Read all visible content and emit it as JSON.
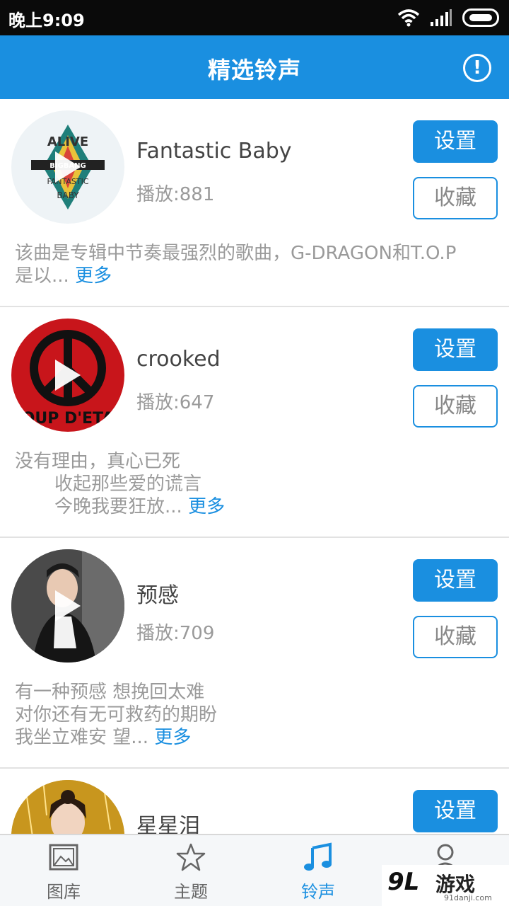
{
  "status_bar": {
    "time": "晚上9:09"
  },
  "header": {
    "title": "精选铃声",
    "info_icon": "!"
  },
  "items": [
    {
      "title": "Fantastic Baby",
      "plays": "播放:881",
      "set_label": "设置",
      "fav_label": "收藏",
      "desc_lines": [
        "该曲是专辑中节奏最强烈的歌曲，G-DRAGON和T.O.P",
        "是以..."
      ],
      "more": "更多",
      "cover_text": [
        "ALIVE",
        "BIGBANG",
        "FANTASTIC",
        "BABY"
      ]
    },
    {
      "title": "crooked",
      "plays": "播放:647",
      "set_label": "设置",
      "fav_label": "收藏",
      "desc_lines": [
        "没有理由，真心已死",
        "收起那些爱的谎言",
        "今晚我要狂放..."
      ],
      "more": "更多",
      "cover_text": [
        "OUP D'ETA"
      ]
    },
    {
      "title": "预感",
      "plays": "播放:709",
      "set_label": "设置",
      "fav_label": "收藏",
      "desc_lines": [
        "有一种预感 想挽回太难",
        "对你还有无可救药的期盼",
        "我坐立难安 望..."
      ],
      "more": "更多"
    },
    {
      "title": "星星泪",
      "set_label": "设置"
    }
  ],
  "bottom_nav": [
    {
      "label": "图库",
      "icon": "gallery-icon"
    },
    {
      "label": "主题",
      "icon": "star-icon"
    },
    {
      "label": "铃声",
      "icon": "music-note-icon",
      "active": true
    },
    {
      "label": "",
      "icon": "person-icon"
    }
  ],
  "watermark": {
    "text": "游戏",
    "logo": "9L",
    "sub": "91danji.com"
  },
  "colors": {
    "accent": "#1a8fe0",
    "status_bar": "#0a0a0a"
  }
}
